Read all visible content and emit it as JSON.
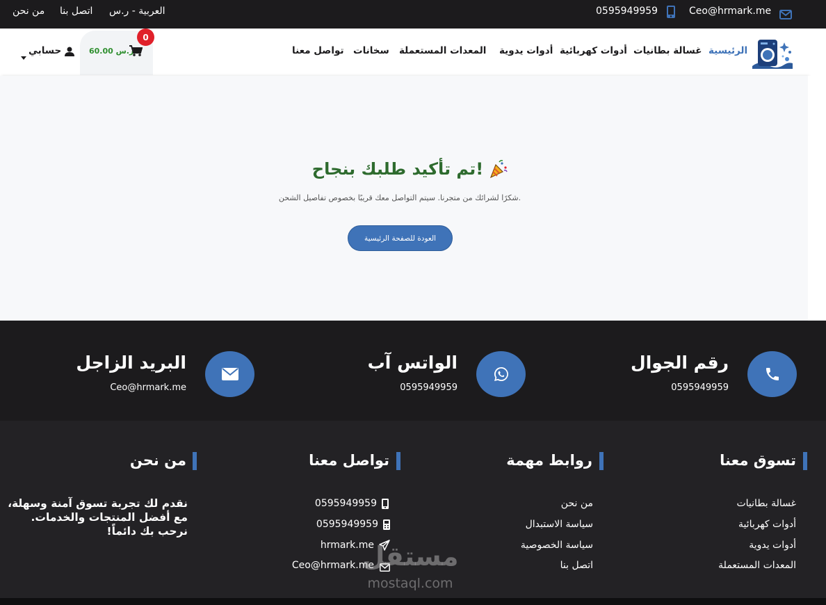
{
  "topbar": {
    "links": [
      "من نحن",
      "اتصل بنا",
      "العربية - ر.س"
    ],
    "phone": "0595949959",
    "email": "Ceo@hrmark.me"
  },
  "navbar": {
    "items": [
      "الرئيسية",
      "غسالة بطانيات",
      "أدوات كهربائية",
      "أدوات يدوية",
      "المعدات المستعملة",
      "سخانات",
      "تواصل معنا"
    ],
    "active_color": "#3f73b8",
    "account_label": "حسابي",
    "cart_total": "60.00 ر.س",
    "cart_count": "0"
  },
  "confirmation": {
    "title": "تم تأكيد طلبك بنجاح!",
    "emoji": "🎉",
    "message": "شكرًا لشرائك من متجرنا. سيتم التواصل معك قريبًا بخصوص تفاصيل الشحن.",
    "button": "العودة للصفحة الرئيسية"
  },
  "contact_strip": {
    "phone_title": "رقم الجوال",
    "phone_value": "0595949959",
    "whatsapp_title": "الواتس آب",
    "whatsapp_value": "0595949959",
    "mail_title": "البريد الزاجل",
    "mail_value": "Ceo@hrmark.me"
  },
  "footer": {
    "shop": {
      "title": "تسوق معنا",
      "links": [
        "غسالة بطانيات",
        "أدوات كهربائية",
        "أدوات يدوية",
        "المعدات المستعملة"
      ]
    },
    "important": {
      "title": "روابط مهمة",
      "links": [
        "من نحن",
        "سياسة الاستبدال",
        "سياسة الخصوصية",
        "اتصل بنا"
      ]
    },
    "contact": {
      "title": "تواصل معنا",
      "items": [
        "0595949959",
        "0595949959",
        "hrmark.me",
        "Ceo@hrmark.me"
      ]
    },
    "about": {
      "title": "من نحن",
      "text": "نقدم لك تجربة تسوق آمنة وسهلة، مع أفضل المنتجات والخدمات. نرحب بك دائماً!"
    }
  },
  "watermark": {
    "arabic": "مستقل",
    "latin": "mostaql.com"
  },
  "colors": {
    "accent": "#3f73b8",
    "title_green": "#2e6b2e",
    "cart_green": "#2f8f2f",
    "dark": "#1c1b1d",
    "badge": "#e0202a"
  }
}
